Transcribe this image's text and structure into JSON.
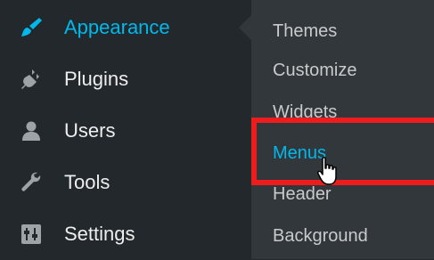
{
  "menu": {
    "items": [
      {
        "label": "Appearance",
        "icon": "paintbrush-icon",
        "current": true
      },
      {
        "label": "Plugins",
        "icon": "plug-icon"
      },
      {
        "label": "Users",
        "icon": "user-icon"
      },
      {
        "label": "Tools",
        "icon": "wrench-icon"
      },
      {
        "label": "Settings",
        "icon": "sliders-icon"
      }
    ]
  },
  "submenu": {
    "items": [
      {
        "label": "Themes"
      },
      {
        "label": "Customize"
      },
      {
        "label": "Widgets"
      },
      {
        "label": "Menus",
        "active": true
      },
      {
        "label": "Header"
      },
      {
        "label": "Background"
      }
    ]
  },
  "colors": {
    "menu_bg": "#23282d",
    "submenu_bg": "#32373c",
    "accent": "#00b9eb",
    "highlight": "#ee1c1c"
  }
}
